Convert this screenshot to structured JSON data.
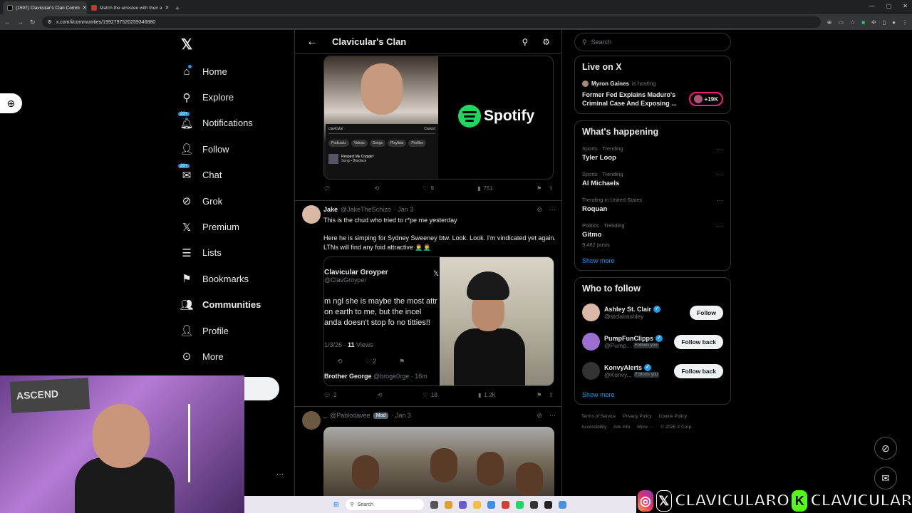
{
  "browser": {
    "tabs": [
      {
        "label": "(1597) Clavicular's Clan Comm",
        "active": true
      },
      {
        "label": "Match the arrestee with their a",
        "active": false
      }
    ],
    "url": "x.com/i/communities/1992797520259346880"
  },
  "nav": {
    "items": [
      {
        "label": "Home",
        "icon": "home-icon"
      },
      {
        "label": "Explore",
        "icon": "search-icon"
      },
      {
        "label": "Notifications",
        "icon": "bell-icon",
        "badge": "20+"
      },
      {
        "label": "Follow",
        "icon": "add-person-icon"
      },
      {
        "label": "Chat",
        "icon": "mail-icon",
        "badge": "20+"
      },
      {
        "label": "Grok",
        "icon": "grok-icon"
      },
      {
        "label": "Premium",
        "icon": "x-icon"
      },
      {
        "label": "Lists",
        "icon": "list-icon"
      },
      {
        "label": "Bookmarks",
        "icon": "bookmark-icon"
      },
      {
        "label": "Communities",
        "icon": "communities-icon",
        "active": true
      },
      {
        "label": "Profile",
        "icon": "person-icon"
      },
      {
        "label": "More",
        "icon": "more-circle-icon"
      }
    ]
  },
  "main": {
    "title": "Clavicular's Clan",
    "media1": {
      "search_text": "clavicular",
      "cancel": "Cancel",
      "chips": [
        "Podcasts",
        "Videos",
        "Songs",
        "Playlists",
        "Profiles"
      ],
      "song": "Respect My Cryppin'",
      "song_meta": "Song • Bluxface",
      "brand": "Spotify"
    },
    "actions1": {
      "likes": "9",
      "views": "751"
    },
    "tweet2": {
      "name": "Jake",
      "handle": "@JakeTheSchizo",
      "date": "· Jan 3",
      "line1": "This is the chud who tried to r*pe me yesterday",
      "line2": "Here he is simping for Sydney Sweeney btw. Look. Look. I'm vindicated yet again. LTNs will find any foid attractive 🤦‍♂️🤦‍♂️",
      "quote": {
        "name": "Clavicular Groyper",
        "handle": "@ClavGroyper",
        "text": "m ngl she is maybe the most attr on earth to me, but the incel anda doesn't stop fo no titties!!",
        "meta_date": "1/3/26 · ",
        "meta_views": "11",
        "meta_views_label": " Views",
        "likes": "2",
        "reply_by": "Brother George",
        "reply_handle": "@broge0rge · 16m"
      },
      "replies": "2",
      "likes": "18",
      "views": "1.2K"
    },
    "tweet3": {
      "name": "_",
      "handle": "@Pablodavee",
      "mod": "Mod",
      "date": "· Jan 3"
    }
  },
  "right": {
    "search_placeholder": "Search",
    "live": {
      "title": "Live on X",
      "host": "Myron Gaines",
      "host_suffix": "is hosting",
      "space_title": "Former Fed Explains Maduro's Criminal Case And Exposing ...",
      "listeners": "+19K"
    },
    "happening": {
      "title": "What's happening",
      "trends": [
        {
          "meta": "Sports · Trending",
          "name": "Tyler Loop",
          "posts": ""
        },
        {
          "meta": "Sports · Trending",
          "name": "Al Michaels",
          "posts": ""
        },
        {
          "meta": "Trending in United States",
          "name": "Roquan",
          "posts": ""
        },
        {
          "meta": "Politics · Trending",
          "name": "Gitmo",
          "posts": "9,482 posts"
        }
      ],
      "show_more": "Show more"
    },
    "who_to_follow": {
      "title": "Who to follow",
      "users": [
        {
          "name": "Ashley St. Clair",
          "handle": "@stclairashley",
          "follows_you": "",
          "button": "Follow",
          "color": "#d9b8a8"
        },
        {
          "name": "PumpFunClipps",
          "handle": "@Pump...",
          "follows_you": "Follows you",
          "button": "Follow back",
          "color": "#9b6fd0"
        },
        {
          "name": "KonvyAlerts",
          "handle": "@Konvy...",
          "follows_you": "Follows you",
          "button": "Follow back",
          "color": "#333333"
        }
      ],
      "show_more": "Show more"
    },
    "footer": {
      "links": [
        "Terms of Service",
        "Privacy Policy",
        "Cookie Policy",
        "Accessibility",
        "Ads info",
        "More ···",
        "© 2026 X Corp."
      ]
    }
  },
  "taskbar": {
    "search": "Search"
  },
  "overlay": {
    "text": "CLAVICULARO",
    "text2": "CLAVICULAR",
    "k": "K"
  },
  "colors": {
    "accent": "#1d9bf0",
    "background": "#000000",
    "border": "#2f3336",
    "spotify": "#1ed760"
  }
}
